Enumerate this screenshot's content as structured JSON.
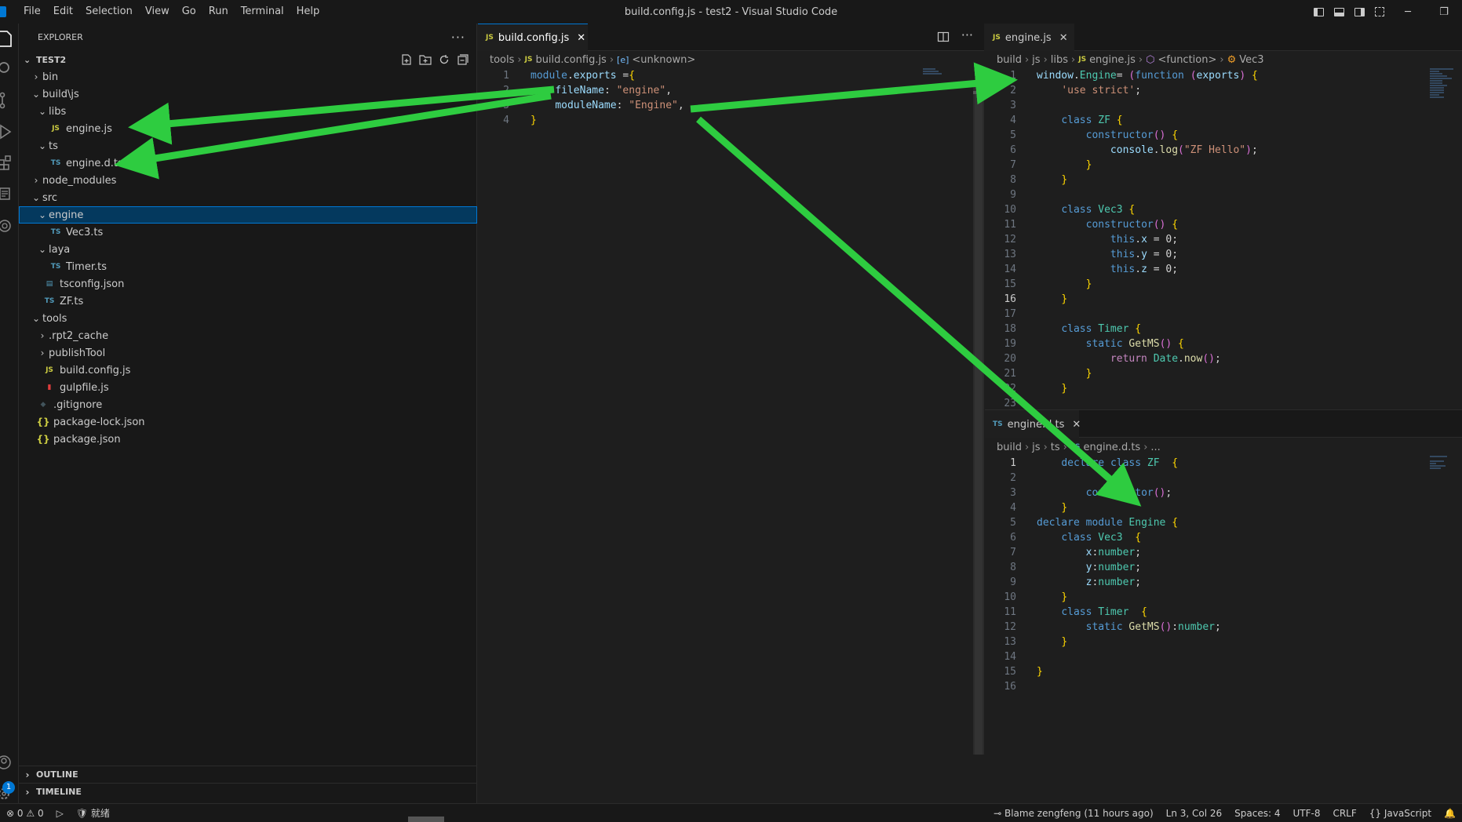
{
  "window": {
    "title": "build.config.js - test2 - Visual Studio Code",
    "menu": [
      "File",
      "Edit",
      "Selection",
      "View",
      "Go",
      "Run",
      "Terminal",
      "Help"
    ]
  },
  "sidebar": {
    "title": "EXPLORER",
    "root": "TEST2",
    "tree": [
      {
        "label": "bin",
        "type": "folder",
        "expanded": false,
        "depth": 1
      },
      {
        "label": "build\\js",
        "type": "folder",
        "expanded": true,
        "depth": 1
      },
      {
        "label": "libs",
        "type": "folder",
        "expanded": true,
        "depth": 2
      },
      {
        "label": "engine.js",
        "type": "js",
        "depth": 3
      },
      {
        "label": "ts",
        "type": "folder",
        "expanded": true,
        "depth": 2
      },
      {
        "label": "engine.d.ts",
        "type": "ts",
        "depth": 3
      },
      {
        "label": "node_modules",
        "type": "folder",
        "expanded": false,
        "depth": 1
      },
      {
        "label": "src",
        "type": "folder",
        "expanded": true,
        "depth": 1
      },
      {
        "label": "engine",
        "type": "folder",
        "expanded": true,
        "depth": 2,
        "selected": true
      },
      {
        "label": "Vec3.ts",
        "type": "ts",
        "depth": 3
      },
      {
        "label": "laya",
        "type": "folder",
        "expanded": true,
        "depth": 2
      },
      {
        "label": "Timer.ts",
        "type": "ts",
        "depth": 3
      },
      {
        "label": "tsconfig.json",
        "type": "cfg",
        "depth": 2
      },
      {
        "label": "ZF.ts",
        "type": "ts",
        "depth": 2
      },
      {
        "label": "tools",
        "type": "folder",
        "expanded": true,
        "depth": 1
      },
      {
        "label": ".rpt2_cache",
        "type": "folder",
        "expanded": false,
        "depth": 2
      },
      {
        "label": "publishTool",
        "type": "folder",
        "expanded": false,
        "depth": 2
      },
      {
        "label": "build.config.js",
        "type": "js",
        "depth": 2
      },
      {
        "label": "gulpfile.js",
        "type": "gulp",
        "depth": 2
      },
      {
        "label": ".gitignore",
        "type": "git",
        "depth": 1
      },
      {
        "label": "package-lock.json",
        "type": "json",
        "depth": 1
      },
      {
        "label": "package.json",
        "type": "json",
        "depth": 1
      }
    ],
    "sections": [
      "OUTLINE",
      "TIMELINE"
    ]
  },
  "editor_left": {
    "tab": "build.config.js",
    "breadcrumb": [
      "tools",
      "build.config.js",
      "<unknown>"
    ],
    "line_numbers": [
      "1",
      "2",
      "3",
      "4"
    ],
    "code": [
      "module.exports ={",
      "    fileName: \"engine\",",
      "    moduleName: \"Engine\",",
      "}"
    ]
  },
  "editor_right_top": {
    "tab": "engine.js",
    "breadcrumb": [
      "build",
      "js",
      "libs",
      "engine.js",
      "<function>",
      "Vec3"
    ],
    "line_numbers": [
      "1",
      "2",
      "3",
      "4",
      "5",
      "6",
      "7",
      "8",
      "9",
      "10",
      "11",
      "12",
      "13",
      "14",
      "15",
      "16",
      "17",
      "18",
      "19",
      "20",
      "21",
      "22",
      "23"
    ],
    "current_line": "16",
    "code": [
      "window.Engine= (function (exports) {",
      "    'use strict';",
      "",
      "    class ZF {",
      "        constructor() {",
      "            console.log(\"ZF Hello\");",
      "        }",
      "    }",
      "",
      "    class Vec3 {",
      "        constructor() {",
      "            this.x = 0;",
      "            this.y = 0;",
      "            this.z = 0;",
      "        }",
      "    }",
      "",
      "    class Timer {",
      "        static GetMS() {",
      "            return Date.now();",
      "        }",
      "    }",
      ""
    ]
  },
  "editor_right_bottom": {
    "tab": "engine.d.ts",
    "breadcrumb": [
      "build",
      "js",
      "ts",
      "engine.d.ts",
      "..."
    ],
    "line_numbers": [
      "1",
      "2",
      "3",
      "4",
      "5",
      "6",
      "7",
      "8",
      "9",
      "10",
      "11",
      "12",
      "13",
      "14",
      "15",
      "16"
    ],
    "current_line": "1",
    "code": [
      "    declare class ZF  {",
      "",
      "        constructor();",
      "    }",
      "declare module Engine {",
      "    class Vec3  {",
      "        x:number;",
      "        y:number;",
      "        z:number;",
      "    }",
      "    class Timer  {",
      "        static GetMS():number;",
      "    }",
      "",
      "}",
      ""
    ]
  },
  "statusbar": {
    "errors": "0",
    "warnings": "0",
    "ready": "就绪",
    "blame": "Blame zengfeng (11 hours ago)",
    "position": "Ln 3, Col 26",
    "spaces": "Spaces: 4",
    "encoding": "UTF-8",
    "eol": "CRLF",
    "language": "JavaScript"
  },
  "colors": {
    "arrow": "#2ecc40",
    "accent": "#0078d4",
    "background": "#1e1e1e"
  }
}
